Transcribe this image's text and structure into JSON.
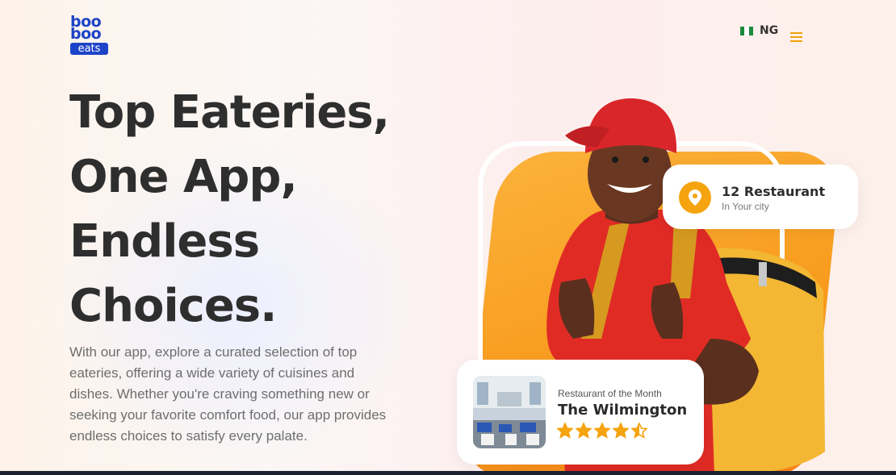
{
  "brand": {
    "logo_line1": "boo",
    "logo_line2": "boo",
    "logo_line3": "eats",
    "color": "#1d44c8"
  },
  "header": {
    "country_code": "NG",
    "flag_colors": [
      "#1a8a3c",
      "#ffffff",
      "#1a8a3c"
    ],
    "menu_icon": "hamburger-menu-icon",
    "accent": "#f0a30a"
  },
  "hero": {
    "title_lines": [
      "Top Eateries,",
      "One App,",
      "Endless",
      "Choices."
    ],
    "description": "With our app, explore a curated selection of top eateries, offering a wide variety of cuisines and dishes. Whether you're craving something new or seeking your favorite comfort food, our app provides endless choices to satisfy every palate."
  },
  "stats_card": {
    "icon": "location-pin-icon",
    "title": "12 Restaurant",
    "subtitle": "In Your city"
  },
  "month_card": {
    "label": "Restaurant of the Month",
    "name": "The Wilmington",
    "rating": 4.5,
    "rating_max": 5,
    "star_color": "#f5a30e"
  }
}
